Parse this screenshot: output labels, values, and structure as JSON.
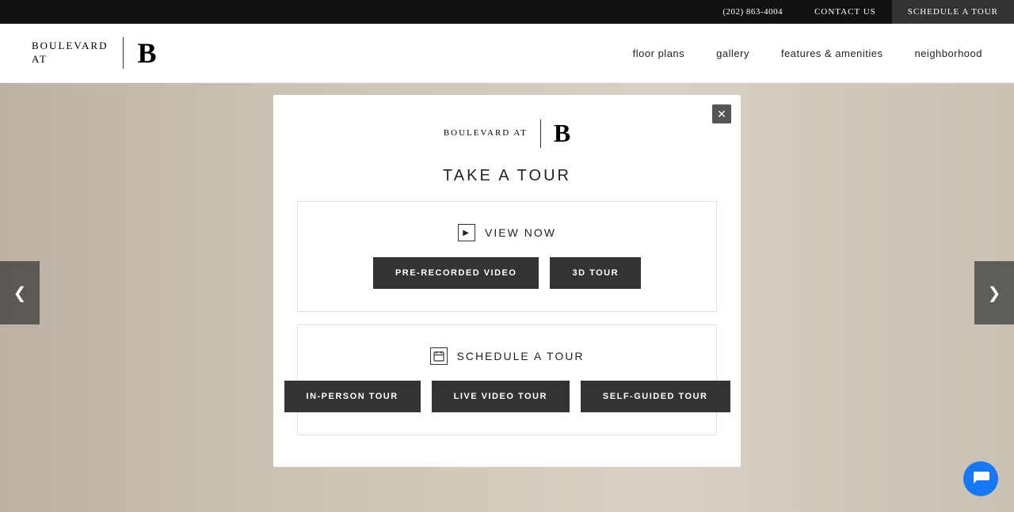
{
  "topbar": {
    "phone": "(202) 863-4004",
    "contact_label": "CONTACT US",
    "schedule_label": "SCHEDULE A TOUR"
  },
  "nav": {
    "logo_line1": "BOULEVARD",
    "logo_line2": "AT",
    "logo_b": "B",
    "links": [
      {
        "label": "floor plans"
      },
      {
        "label": "gallery"
      },
      {
        "label": "features & amenities"
      },
      {
        "label": "neighborhood"
      }
    ]
  },
  "slider": {
    "left_arrow": "❮",
    "right_arrow": "❯"
  },
  "modal": {
    "logo_line1": "BOULEVARD",
    "logo_line2": "AT",
    "logo_b": "B",
    "title": "TAKE A TOUR",
    "close_symbol": "✕",
    "view_now_label": "VIEW NOW",
    "btn_prerecorded": "PRE-RECORDED VIDEO",
    "btn_3d": "3D TOUR",
    "schedule_label": "SCHEDULE A TOUR",
    "btn_inperson": "IN-PERSON TOUR",
    "btn_livevideo": "LIVE VIDEO TOUR",
    "btn_selfguided": "SELF-GUIDED TOUR"
  },
  "chat": {
    "icon": "💬"
  }
}
